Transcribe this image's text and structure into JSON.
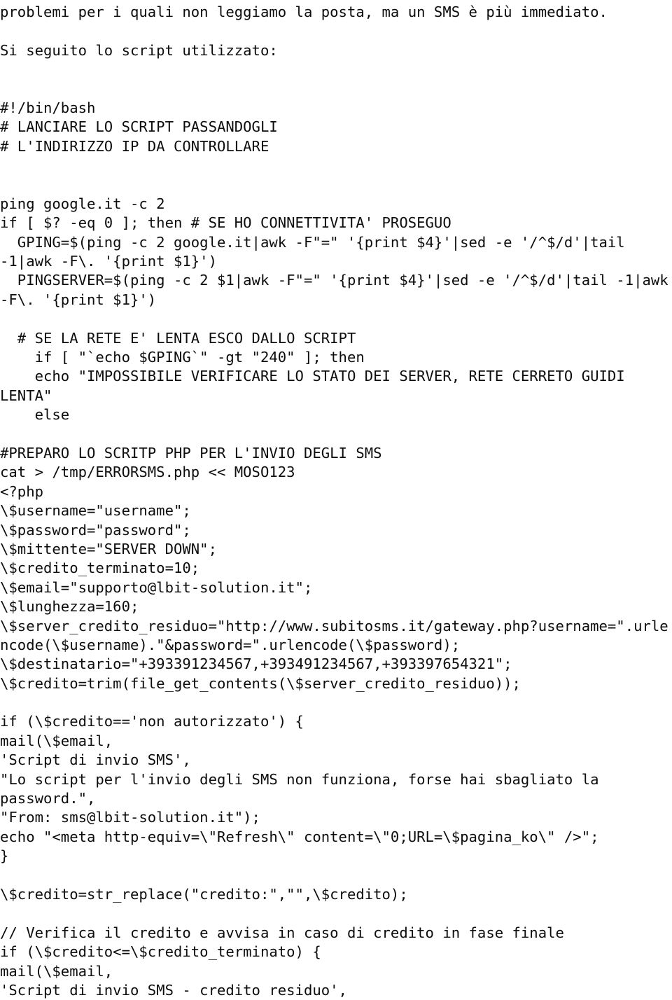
{
  "document": {
    "language": "it",
    "text_color": "#0d0d0d",
    "background_color": "#ffffff",
    "intro": {
      "paragraph_1": "problemi per i quali non leggiamo la posta, ma un SMS è più immediato.",
      "paragraph_2": "Si seguito lo script utilizzato:"
    },
    "script_lines": [
      "#!/bin/bash",
      "# LANCIARE LO SCRIPT PASSANDOGLI",
      "# L'INDIRIZZO IP DA CONTROLLARE",
      "ping google.it -c 2",
      "if [ $? -eq 0 ]; then # SE HO CONNETTIVITA' PROSEGUO",
      "  GPING=$(ping -c 2 google.it|awk -F\"=\" '{print $4}'|sed -e '/^$/d'|tail",
      "-1|awk -F\\. '{print $1}')",
      "  PINGSERVER=$(ping -c 2 $1|awk -F\"=\" '{print $4}'|sed -e '/^$/d'|tail -1|awk",
      "-F\\. '{print $1}')",
      "  # SE LA RETE E' LENTA ESCO DALLO SCRIPT",
      "    if [ \"`echo $GPING`\" -gt \"240\" ]; then",
      "    echo \"IMPOSSIBILE VERIFICARE LO STATO DEI SERVER, RETE CERRETO GUIDI",
      "LENTA\"",
      "    else",
      "#PREPARO LO SCRITP PHP PER L'INVIO DEGLI SMS",
      "cat > /tmp/ERRORSMS.php << MOSO123",
      "<?php",
      "\\$username=\"username\";",
      "\\$password=\"password\";",
      "\\$mittente=\"SERVER DOWN\";",
      "\\$credito_terminato=10;",
      "\\$email=\"supporto@lbit-solution.it\";",
      "\\$lunghezza=160;",
      "\\$server_credito_residuo=\"http://www.subitosms.it/gateway.php?username=\".urle",
      "ncode(\\$username).\"&password=\".urlencode(\\$password);",
      "\\$destinatario=\"+393391234567,+393491234567,+393397654321\";",
      "\\$credito=trim(file_get_contents(\\$server_credito_residuo));",
      "if (\\$credito=='non autorizzato') {",
      "mail(\\$email,",
      "'Script di invio SMS',",
      "\"Lo script per l'invio degli SMS non funziona, forse hai sbagliato la",
      "password.\",",
      "\"From: sms@lbit-solution.it\");",
      "echo \"<meta http-equiv=\\\"Refresh\\\" content=\\\"0;URL=\\$pagina_ko\\\" />\";",
      "}",
      "\\$credito=str_replace(\"credito:\",\"\",\\$credito);",
      "// Verifica il credito e avvisa in caso di credito in fase finale",
      "if (\\$credito<=\\$credito_terminato) {",
      "mail(\\$email,",
      "'Script di invio SMS - credito residuo',"
    ]
  }
}
